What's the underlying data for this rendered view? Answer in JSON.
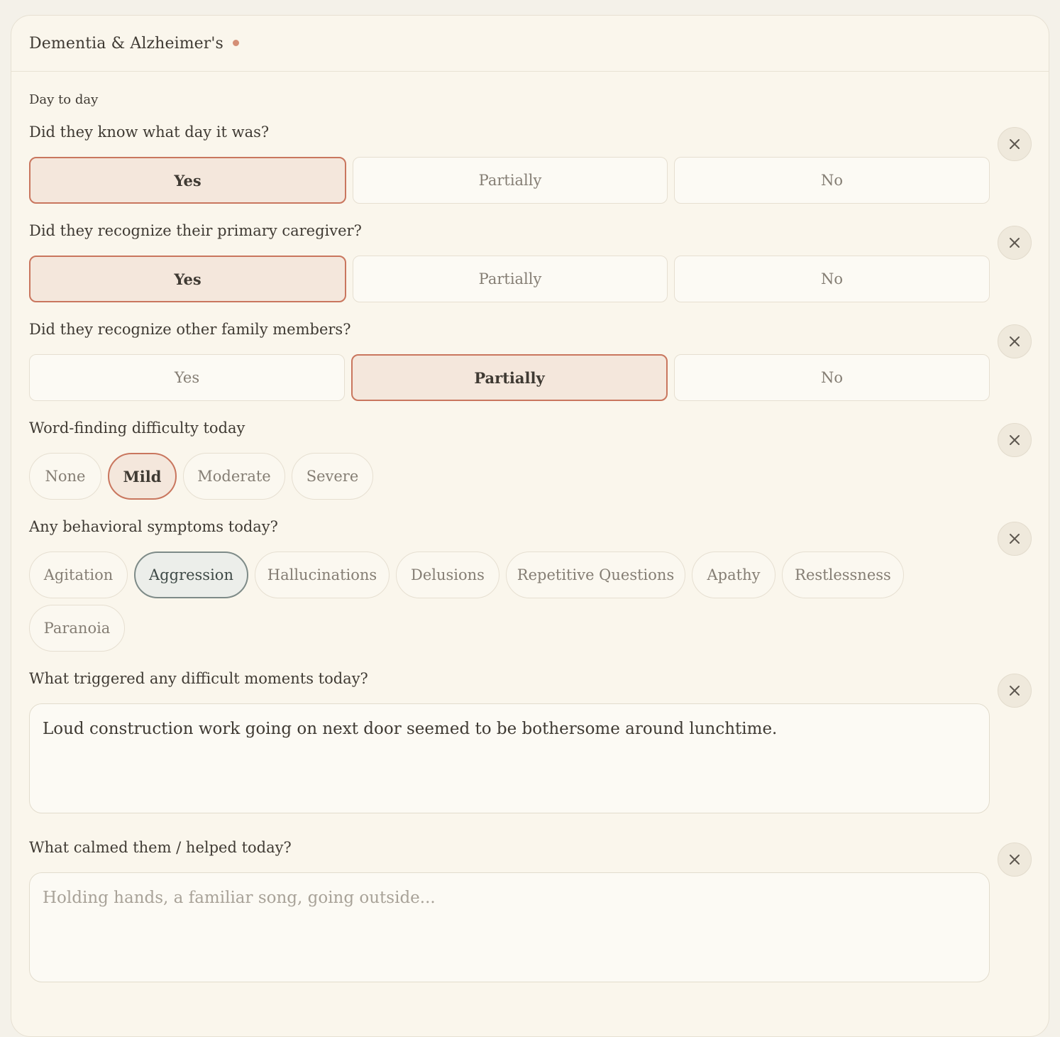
{
  "header": {
    "title": "Dementia & Alzheimer's"
  },
  "section_label": "Day to day",
  "questions": [
    {
      "label": "Did they know what day it was?",
      "options": [
        "Yes",
        "Partially",
        "No"
      ],
      "selected": "Yes"
    },
    {
      "label": "Did they recognize their primary caregiver?",
      "options": [
        "Yes",
        "Partially",
        "No"
      ],
      "selected": "Yes"
    },
    {
      "label": "Did they recognize other family members?",
      "options": [
        "Yes",
        "Partially",
        "No"
      ],
      "selected": "Partially"
    }
  ],
  "word_finding": {
    "label": "Word-finding difficulty today",
    "options": [
      "None",
      "Mild",
      "Moderate",
      "Severe"
    ],
    "selected": "Mild"
  },
  "behavioral": {
    "label": "Any behavioral symptoms today?",
    "options": [
      "Agitation",
      "Aggression",
      "Hallucinations",
      "Delusions",
      "Repetitive Questions",
      "Apathy",
      "Restlessness",
      "Paranoia"
    ],
    "selected": [
      "Aggression"
    ]
  },
  "triggers": {
    "label": "What triggered any difficult moments today?",
    "value": "Loud construction work going on next door seemed to be bothersome around lunchtime.",
    "placeholder": ""
  },
  "calmed": {
    "label": "What calmed them / helped today?",
    "value": "",
    "placeholder": "Holding hands, a familiar song, going outside..."
  },
  "colors": {
    "accent": "#c9765e",
    "accent_bg": "#f4e7dc",
    "cool_accent": "#7e8b88",
    "background": "#faf6ec"
  },
  "icons": {
    "clear": "close-icon",
    "status": "status-dot"
  }
}
